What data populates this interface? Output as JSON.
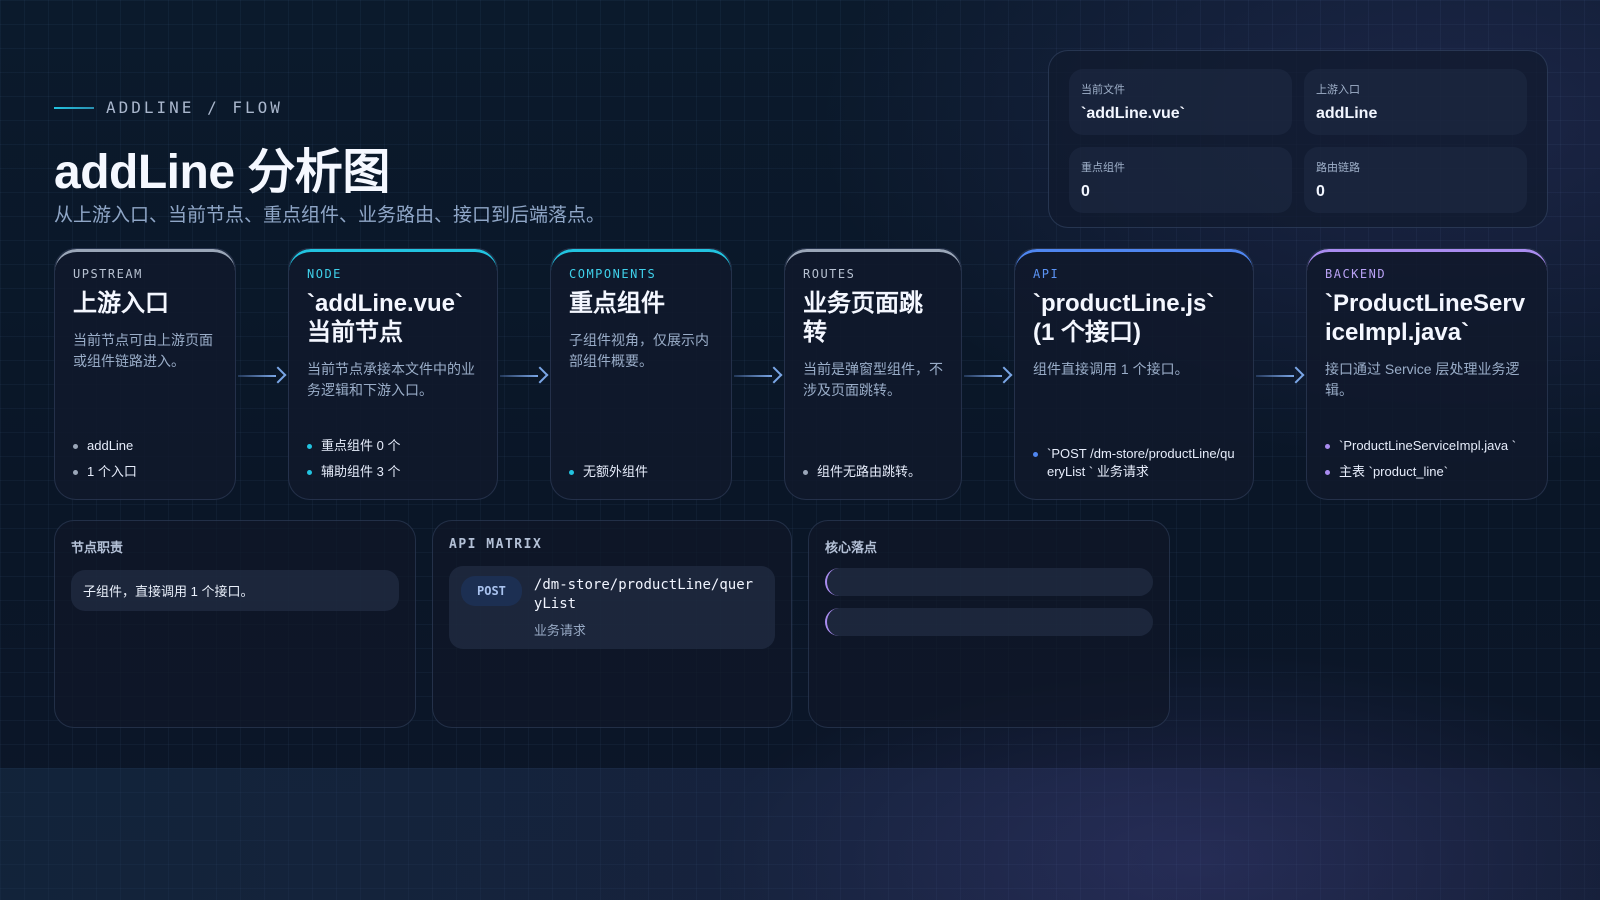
{
  "header": {
    "eyebrow": "ADDLINE / FLOW",
    "title": "addLine 分析图",
    "subtitle": "从上游入口、当前节点、重点组件、业务路由、接口到后端落点。"
  },
  "summary": [
    {
      "label": "当前文件",
      "value": "`addLine.vue`"
    },
    {
      "label": "上游入口",
      "value": "addLine"
    },
    {
      "label": "重点组件",
      "value": "0"
    },
    {
      "label": "路由链路",
      "value": "0"
    }
  ],
  "cards": [
    {
      "tag": "UPSTREAM",
      "heading": "上游入口",
      "desc": "当前节点可由上游页面或组件链路进入。",
      "items": [
        "addLine",
        "1 个入口"
      ]
    },
    {
      "tag": "NODE",
      "heading": "`addLine.vue` 当前节点",
      "desc": "当前节点承接本文件中的业务逻辑和下游入口。",
      "items": [
        "重点组件 0 个",
        "辅助组件 3 个"
      ]
    },
    {
      "tag": "COMPONENTS",
      "heading": "重点组件",
      "desc": "子组件视角，仅展示内部组件概要。",
      "items": [
        "无额外组件"
      ]
    },
    {
      "tag": "ROUTES",
      "heading": "业务页面跳转",
      "desc": "当前是弹窗型组件，不涉及页面跳转。",
      "items": [
        "组件无路由跳转。"
      ]
    },
    {
      "tag": "API",
      "heading": "`productLine.js` (1 个接口)",
      "desc": "组件直接调用 1 个接口。",
      "items": [
        "`POST /dm-store/productLine/queryList ` 业务请求"
      ]
    },
    {
      "tag": "BACKEND",
      "heading": "`ProductLineServiceImpl.java`",
      "desc": "接口通过 Service 层处理业务逻辑。",
      "items": [
        "`ProductLineServiceImpl.java `",
        "主表 `product_line`"
      ]
    }
  ],
  "panels": {
    "duty": {
      "title": "节点职责",
      "text": "子组件，直接调用 1 个接口。"
    },
    "api": {
      "title": "API MATRIX",
      "method": "POST",
      "path": "/dm-store/productLine/queryList",
      "desc": "业务请求"
    },
    "core": {
      "title": "核心落点"
    }
  },
  "colors": {
    "upstream": "#9aa6b8",
    "node": "#22c3e0",
    "components": "#22c3e0",
    "routes": "#9aa6b8",
    "api": "#4f86f0",
    "backend": "#a98cf0"
  }
}
